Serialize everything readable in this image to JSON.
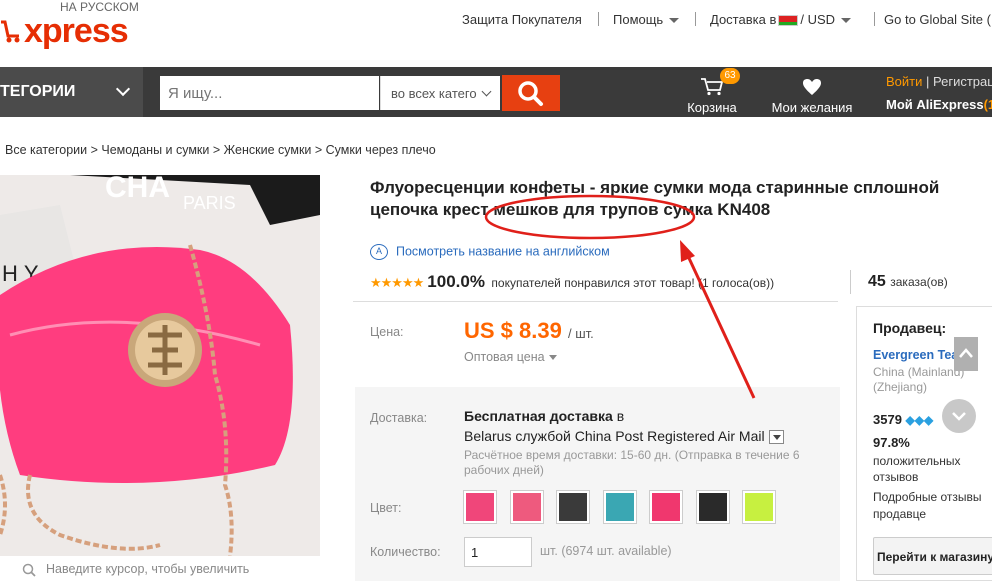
{
  "header": {
    "logo_sub": "НА РУССКОМ",
    "logo_text": "xpress",
    "links": {
      "buyer_protection": "Защита Покупателя",
      "help": "Помощь",
      "delivery": "Доставка в",
      "currency": "/ USD",
      "global_site": "Go to Global Site ("
    }
  },
  "navbar": {
    "categories_label": "ТЕГОРИИ",
    "search_placeholder": "Я ищу...",
    "search_scope": "во всех катего",
    "cart_label": "Корзина",
    "cart_count": "63",
    "wishlist_label": "Мои желания",
    "login_label": "Войти",
    "register_label": "| Регистрац",
    "my_ali_label": "Мой AliExpress",
    "my_ali_suffix": "(1"
  },
  "breadcrumb": "Все категории > Чемоданы и сумки > Женские сумки > Сумки через плечо",
  "product": {
    "image_text_brand": "CHA",
    "image_text_city": "PARIS",
    "image_text_side": "HY",
    "zoom_hint": "Наведите курсор, чтобы увеличить",
    "title": "Флуоресценции конфеты - яркие сумки мода старинные сплошной цепочка крест мешков для трупов сумка KN408",
    "translate_link": "Посмотреть название на английском",
    "rating_pct": "100.0%",
    "rating_text": "покупателей понравился этот товар! (1 голоса(ов))",
    "orders_count": "45",
    "orders_label": "заказа(ов)",
    "price_label": "Цена:",
    "price": "US $ 8.39",
    "price_unit": "/ шт.",
    "wholesale": "Оптовая цена",
    "delivery_label": "Доставка:",
    "ship_free": "Бесплатная доставка",
    "ship_in": " в",
    "ship_method": "Belarus службой China Post Registered Air Mail",
    "ship_time": "Расчётное время доставки: 15-60 дн. (Отправка в течение 6 рабочих дней)",
    "color_label": "Цвет:",
    "quantity_label": "Количество:",
    "quantity_value": "1",
    "quantity_avail": "шт. (6974 шт. available)"
  },
  "swatch_colors": [
    "#f0467a",
    "#ee5a7e",
    "#3a3a3a",
    "#3aa7b3",
    "#f0376e",
    "#2a2a2a",
    "#c7f040"
  ],
  "seller": {
    "heading": "Продавец:",
    "name": "Evergreen Team",
    "location": "China (Mainland) (Zhejiang)",
    "score": "3579",
    "positive_pct": "97.8%",
    "positive_label": "положительных отзывов",
    "feedback_label": "Подробные отзывы продавце",
    "goto_store": "Перейти к магазину"
  },
  "colors": {
    "brand": "#e62e04",
    "price": "#ff6600",
    "link": "#2a6bbd",
    "navbar": "#3a3a3a",
    "search_btn": "#e74011",
    "annotation": "#e0201a"
  }
}
